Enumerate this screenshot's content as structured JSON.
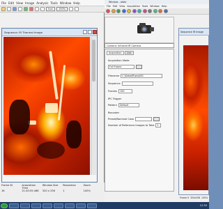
{
  "left_app": {
    "menu": [
      "File",
      "Edit",
      "View",
      "Image",
      "Analysis",
      "Tools",
      "Window",
      "Help"
    ],
    "toolbar": {
      "palette_select": "Iron",
      "zoom_select": "100%"
    },
    "image_window": {
      "title": "Sequence: IR Thermal Image"
    },
    "status": {
      "headers": [
        "Frame ID",
        "Acquisition Time",
        "Window Size",
        "Resolution",
        "Zoom"
      ],
      "values": [
        "16",
        "21:40:55.468",
        "320 x 256",
        "1",
        "100%"
      ]
    }
  },
  "right_app": {
    "title": "Window - altair",
    "menu": [
      "File",
      "Edit",
      "View",
      "Acquisition",
      "Tools",
      "Window",
      "Help"
    ],
    "camera_select": "Camera: Infrared IR Camera",
    "tabs": [
      "Acquisition",
      "Live"
    ],
    "fields": {
      "acq_mode_label": "Acquisition Mode",
      "acq_mode_value": "Full Frame",
      "filename_label": "Filename",
      "filename_value": "C:\\Data\\IR\\seq001",
      "sequence_label": "Sequence",
      "frames_label": "Frames",
      "frames_value": "100",
      "ipc_label": "IPC Trigger",
      "pattern_label": "Pattern",
      "pattern_value": "Default",
      "recorder_label": "Recorder",
      "preset_label": "Preset/Nominal Case",
      "number_label": "Number of Reference Images to Take",
      "number_value": "1"
    },
    "child_window": {
      "title": "Sequence IR Image"
    },
    "status": [
      "Frame 0",
      "320x256",
      "100%"
    ]
  },
  "taskbar": {
    "clock": "12:35"
  }
}
